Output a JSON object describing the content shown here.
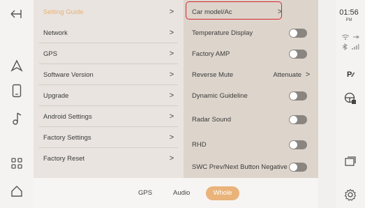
{
  "left_menu": {
    "items": [
      {
        "label": "Setting Guide",
        "active": true
      },
      {
        "label": "Network"
      },
      {
        "label": "GPS"
      },
      {
        "label": "Software Version"
      },
      {
        "label": "Upgrade"
      },
      {
        "label": "Android Settings"
      },
      {
        "label": "Factory Settings"
      },
      {
        "label": "Factory Reset"
      }
    ],
    "chevron": ">"
  },
  "right_menu": {
    "car_model": "Car model/Ac",
    "temperature_display": "Temperature Display",
    "factory_amp": "Factory AMP",
    "reverse_mute": "Reverse Mute",
    "reverse_mute_value": "Attenuate",
    "dynamic_guideline": "Dynamic Guideline",
    "radar_sound": "Radar Sound",
    "rhd": "RHD",
    "swc": "SWC Prev/Next Button Negative",
    "chevron": ">"
  },
  "bottom_tabs": {
    "gps": "GPS",
    "audio": "Audio",
    "whole": "Whole",
    "active": "Whole"
  },
  "status": {
    "time": "01:56",
    "ampm": "PM",
    "p_icon": "P"
  },
  "colors": {
    "accent": "#e9b37a",
    "highlight": "#d8262e",
    "toggle": "#8a8580"
  },
  "icons": [
    "back-icon",
    "navigation-icon",
    "phone-icon",
    "music-icon",
    "apps-icon",
    "home-icon",
    "wifi-icon",
    "usb-icon",
    "bluetooth-icon",
    "signal-icon",
    "parking-icon",
    "steering-wheel-icon",
    "recent-apps-icon",
    "settings-icon"
  ]
}
